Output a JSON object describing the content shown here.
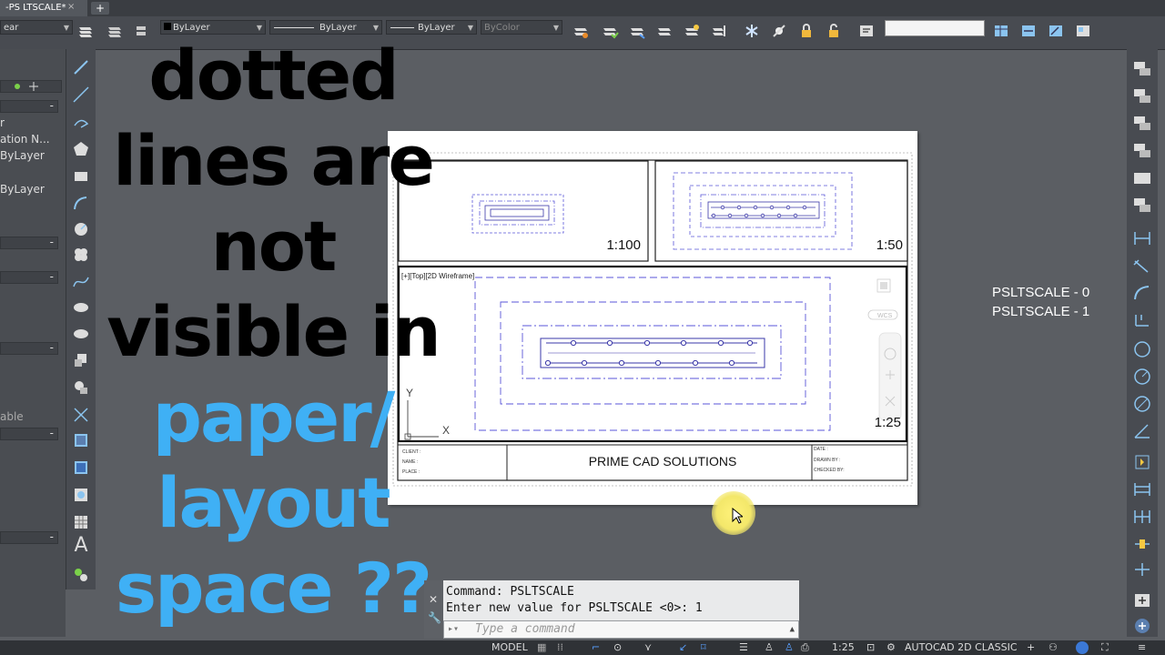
{
  "tabs": {
    "active": "-PS LTSCALE*",
    "close": "×",
    "add": "+"
  },
  "toolbar": {
    "layer_dropdown": "ear",
    "color_dropdown": "ByLayer",
    "linetype_dropdown": "ByLayer",
    "lineweight_dropdown": "ByLayer",
    "plotstyle_dropdown": "ByColor"
  },
  "left_palette": {
    "row1": "r",
    "row2": "ation  N...",
    "row3": "ByLayer",
    "row4": "ByLayer",
    "row5": "able",
    "collapse": "-"
  },
  "overlay": {
    "line1": "dotted",
    "line2": "lines are",
    "line3": "not",
    "line4": "visible in",
    "line5": "paper/",
    "line6": "layout",
    "line7": "space ??"
  },
  "drawing": {
    "scale_top_left": "1:100",
    "scale_top_right": "1:50",
    "scale_main": "1:25",
    "viewport_label": "[+][Top][2D Wireframe]",
    "wcs": "WCS",
    "ucs_y": "Y",
    "ucs_x": "X",
    "title_block_company": "PRIME CAD SOLUTIONS",
    "client_label": "CLIENT :",
    "name_label": "NAME   :",
    "place_label": "PLACE  :",
    "date_label": "DATE :",
    "drawn_label": "DRAWN BY :",
    "checked_label": "CHECKED BY:"
  },
  "notes": {
    "pslt0": "PSLTSCALE - 0",
    "pslt1": "PSLTSCALE - 1"
  },
  "command": {
    "line1": "Command: PSLTSCALE",
    "line2": "Enter new value for PSLTSCALE <0>: 1",
    "placeholder": "Type a command"
  },
  "statusbar": {
    "model": "MODEL",
    "scale": "1:25",
    "workspace": "AUTOCAD 2D CLASSIC"
  },
  "colors": {
    "dash": "#5a56d8",
    "solid": "#3a37a8"
  }
}
